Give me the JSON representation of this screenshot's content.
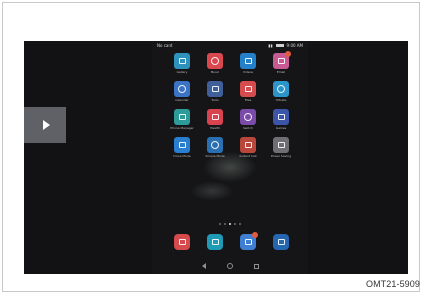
{
  "status_bar": {
    "carrier": "No card",
    "time": "9:00 AM"
  },
  "apps": [
    {
      "label": "Gallery",
      "icon": "gallery-icon",
      "color": "#2d93bd"
    },
    {
      "label": "Music",
      "icon": "music-icon",
      "color": "#d9484e"
    },
    {
      "label": "Videos",
      "icon": "videos-icon",
      "color": "#2480c8"
    },
    {
      "label": "Email",
      "icon": "email-icon",
      "color": "#c85a93",
      "badge": true
    },
    {
      "label": "Calendar",
      "icon": "calendar-icon",
      "color": "#3b74c4"
    },
    {
      "label": "Tools",
      "icon": "tools-icon",
      "color": "#3e5f9a"
    },
    {
      "label": "Files",
      "icon": "files-icon",
      "color": "#d64b4e"
    },
    {
      "label": "HiSuite",
      "icon": "hisuite-icon",
      "color": "#2b95c9"
    },
    {
      "label": "Phone Manager",
      "icon": "phone-manager-icon",
      "color": "#2d9b9a"
    },
    {
      "label": "Health",
      "icon": "health-icon",
      "color": "#d9434f"
    },
    {
      "label": "Switch",
      "icon": "switch-icon",
      "color": "#7a4ba8"
    },
    {
      "label": "Games",
      "icon": "games-icon",
      "color": "#3b55a8"
    },
    {
      "label": "Drive Mode",
      "icon": "drive-mode-icon",
      "color": "#2a7ed0"
    },
    {
      "label": "Simple Mode",
      "icon": "simple-mode-icon",
      "color": "#2b6fb3"
    },
    {
      "label": "Instant Call",
      "icon": "instant-call-icon",
      "color": "#b9473c"
    },
    {
      "label": "Power Saving",
      "icon": "power-saving-icon",
      "color": "#6e6e73"
    }
  ],
  "dock": [
    {
      "icon": "contacts-icon",
      "color": "#d54a4c"
    },
    {
      "icon": "phone-icon",
      "color": "#1f9bb5"
    },
    {
      "icon": "messaging-icon",
      "color": "#3f7fd3",
      "badge": true
    },
    {
      "icon": "browser-icon",
      "color": "#2466b0"
    }
  ],
  "page_indicator": {
    "count": 5,
    "active": 2
  },
  "caption": "OMT21-5909"
}
